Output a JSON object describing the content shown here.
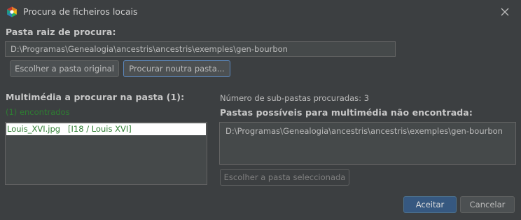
{
  "window": {
    "title": "Procura de ficheiros locais",
    "icon": "app-logo-icon",
    "close_icon": "close-icon"
  },
  "root_section": {
    "label": "Pasta raiz de procura:",
    "path_value": "D:\\Programas\\Genealogia\\ancestris\\ancestris\\exemples\\gen-bourbon",
    "choose_original_label": "Escolher a pasta original",
    "search_other_label": "Procurar noutra pasta..."
  },
  "media_section": {
    "label": "Multimédia a procurar na pasta (1):",
    "found_text": "(1) encontrados",
    "found_color": "#2e7d32",
    "files": [
      {
        "name": "Louis_XVI.jpg",
        "ref": "[I18 / Louis XVI]"
      }
    ]
  },
  "folders_section": {
    "subfolder_count_text": "Número de sub-pastas procuradas: 3",
    "label": "Pastas possíveis para multimédia não encontrada:",
    "folders": [
      "D:\\Programas\\Genealogia\\ancestris\\ancestris\\exemples\\gen-bourbon"
    ],
    "choose_selected_label": "Escolher a pasta seleccionada"
  },
  "footer": {
    "accept_label": "Aceitar",
    "cancel_label": "Cancelar"
  },
  "colors": {
    "background": "#3c3f41",
    "field_background": "#45494a",
    "primary_button": "#365880",
    "selected_row": "#ffffff"
  }
}
